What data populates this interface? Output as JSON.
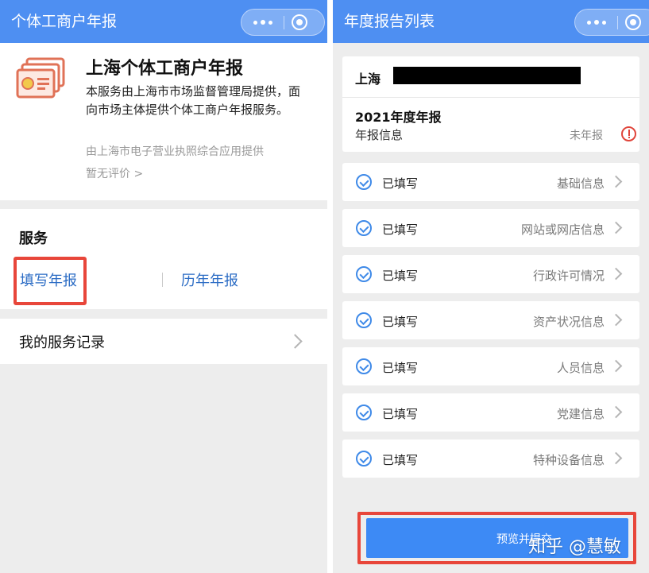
{
  "left_panel": {
    "nav_title": "个体工商户年报",
    "service_info": {
      "title": "上海个体工商户年报",
      "description": "本服务由上海市市场监督管理局提供，面向市场主体提供个体工商户年报服务。",
      "provider": "由上海市电子营业执照综合应用提供",
      "rating": "暂无评价 >"
    },
    "services": {
      "heading": "服务",
      "fill_report": "填写年报",
      "history_reports": "历年年报"
    },
    "records_label": "我的服务记录"
  },
  "right_panel": {
    "nav_title": "年度报告列表",
    "company_prefix": "上海",
    "year_title": "2021年度年报",
    "report_info_label": "年报信息",
    "report_status": "未年报",
    "sections": [
      {
        "status": "已填写",
        "name": "基础信息"
      },
      {
        "status": "已填写",
        "name": "网站或网店信息"
      },
      {
        "status": "已填写",
        "name": "行政许可情况"
      },
      {
        "status": "已填写",
        "name": "资产状况信息"
      },
      {
        "status": "已填写",
        "name": "人员信息"
      },
      {
        "status": "已填写",
        "name": "党建信息"
      },
      {
        "status": "已填写",
        "name": "特种设备信息"
      }
    ],
    "submit_label": "预览并提交"
  },
  "watermark": "知乎 @慧敏",
  "colors": {
    "nav_blue": "#4e8ff2",
    "submit_blue": "#3d8af5",
    "highlight_red": "#e8463a",
    "link_blue": "#2a6bc4",
    "check_blue": "#3f8ae8"
  },
  "icons": {
    "app_icon": "certificate-icon",
    "more": "more-dots-icon",
    "close": "target-circle-icon",
    "row_check": "check-circle-icon",
    "warning": "exclamation-circle-icon",
    "chevron": "chevron-right-icon"
  }
}
